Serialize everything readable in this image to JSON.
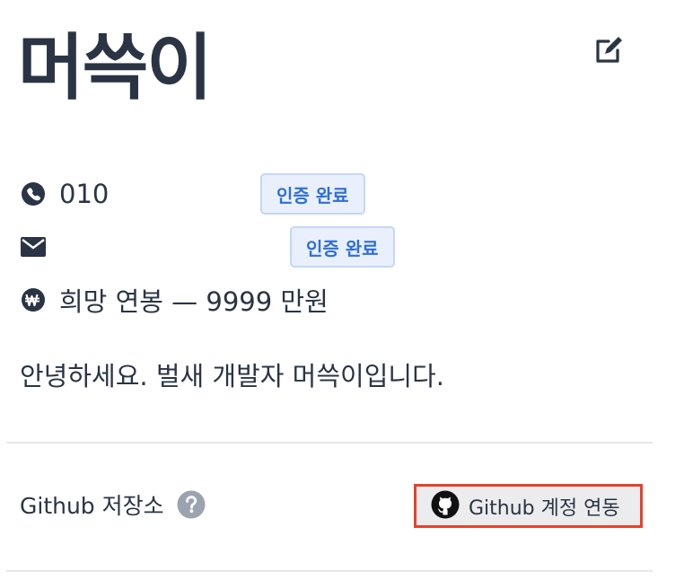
{
  "profile": {
    "name": "머쓱이",
    "phone": "010",
    "phone_badge": "인증 완료",
    "email": "",
    "email_badge": "인증 완료",
    "salary": "희망 연봉 — 9999 만원",
    "intro": "안녕하세요. 벌새 개발자 머쓱이입니다."
  },
  "github": {
    "section_label": "Github 저장소",
    "connect_button": "Github 계정 연동"
  },
  "icons": {
    "edit": "edit-icon",
    "phone": "phone-icon",
    "email": "mail-icon",
    "salary": "won-icon",
    "help": "question-icon",
    "github": "github-icon"
  },
  "colors": {
    "text": "#2b3444",
    "badge_bg": "#e9f0fc",
    "badge_text": "#2f6ed8",
    "highlight_border": "#e8412a",
    "help_icon": "#9aa3ae"
  }
}
